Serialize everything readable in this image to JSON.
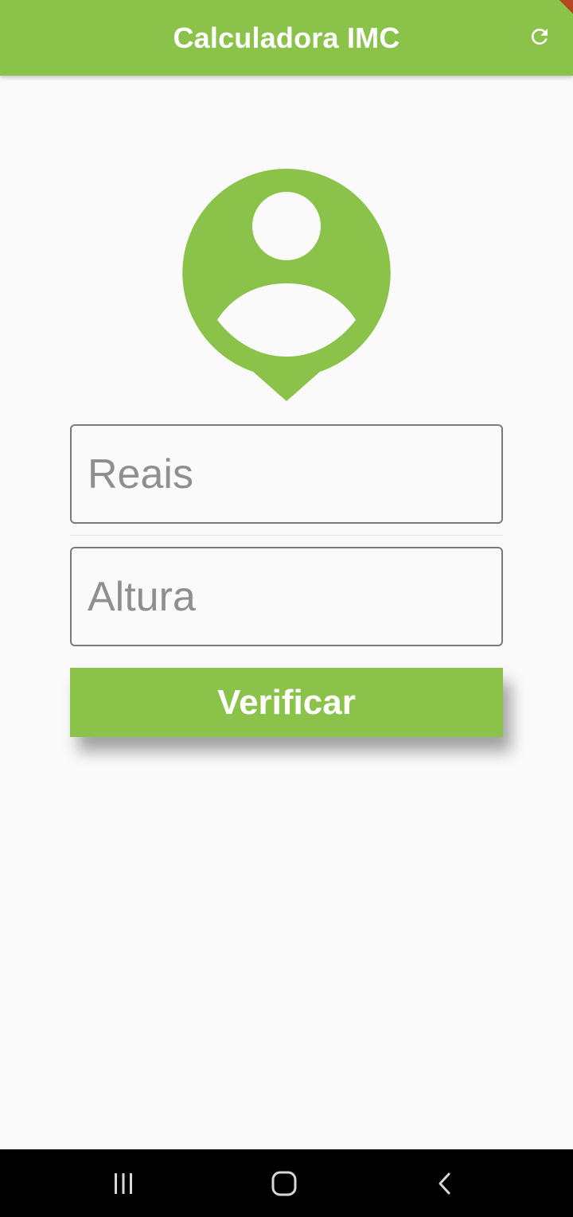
{
  "app_bar": {
    "title": "Calculadora IMC",
    "refresh_icon": "refresh-icon",
    "background": "#8bc34a"
  },
  "avatar": {
    "icon": "person-pin-icon",
    "color": "#8bc34a"
  },
  "form": {
    "weight_placeholder": "Reais",
    "height_placeholder": "Altura",
    "weight_value": "",
    "height_value": ""
  },
  "verify_button": {
    "label": "Verificar"
  },
  "nav_bar": {
    "recents_icon": "recents-icon",
    "home_icon": "home-icon",
    "back_icon": "back-icon"
  }
}
